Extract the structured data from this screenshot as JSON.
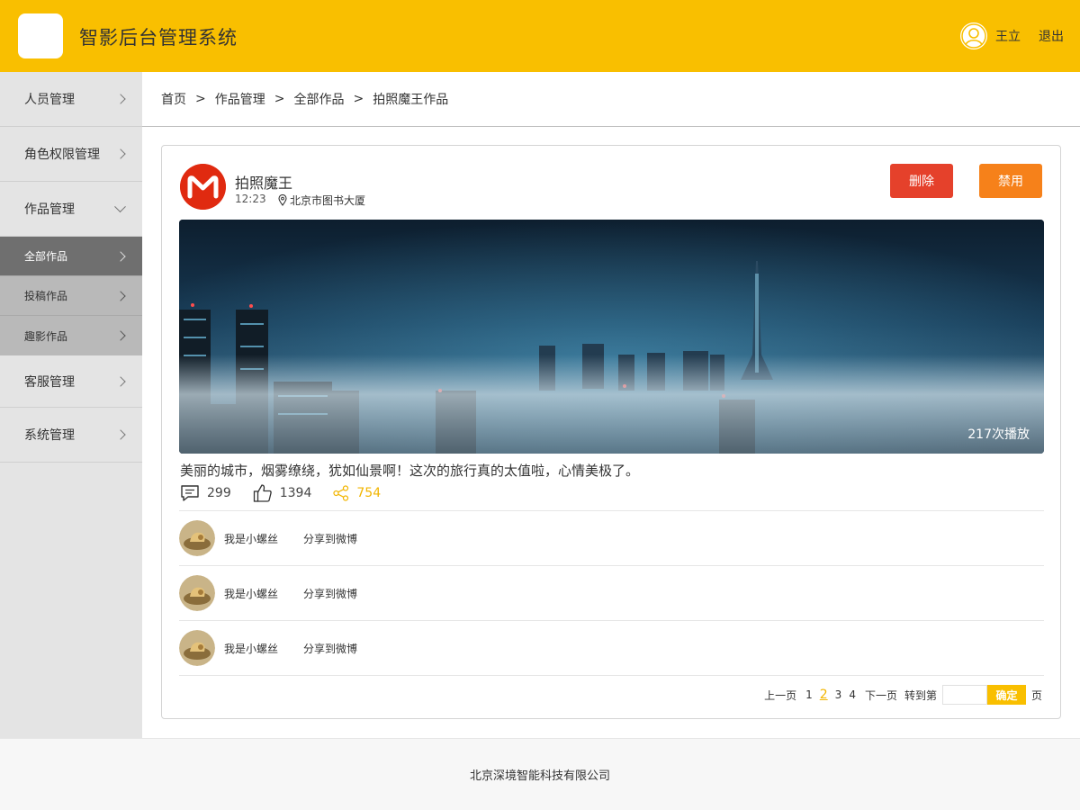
{
  "header": {
    "app_title": "智影后台管理系统",
    "user_name": "王立",
    "logout_label": "退出",
    "brand_color": "#f9bf00"
  },
  "sidebar": {
    "items": [
      {
        "label": "人员管理"
      },
      {
        "label": "角色权限管理"
      },
      {
        "label": "作品管理",
        "expanded": true
      },
      {
        "label": "全部作品",
        "sub": true,
        "active": true
      },
      {
        "label": "投稿作品",
        "sub": true
      },
      {
        "label": "趣影作品",
        "sub": true
      },
      {
        "label": "客服管理"
      },
      {
        "label": "系统管理"
      }
    ]
  },
  "breadcrumb": {
    "items": [
      "首页",
      "作品管理",
      "全部作品",
      "拍照魔王作品"
    ],
    "separator": ">"
  },
  "post": {
    "author": "拍照魔王",
    "time": "12:23",
    "location": "北京市图书大厦",
    "delete_label": "删除",
    "ban_label": "禁用",
    "play_count": "217次播放",
    "caption": "美丽的城市，烟雾缭绕，犹如仙景啊！这次的旅行真的太值啦，心情美极了。",
    "comments": "299",
    "likes": "1394",
    "shares": "754",
    "delete_color": "#e5412b",
    "ban_color": "#f6811a",
    "share_color": "#f2b500"
  },
  "share_list": [
    {
      "name": "我是小螺丝",
      "action": "分享到微博"
    },
    {
      "name": "我是小螺丝",
      "action": "分享到微博"
    },
    {
      "name": "我是小螺丝",
      "action": "分享到微博"
    }
  ],
  "pagination": {
    "prev_label": "上一页",
    "pages": [
      "1",
      "2",
      "3",
      "4"
    ],
    "current": "2",
    "next_label": "下一页",
    "goto_label": "转到第",
    "confirm_label": "确定",
    "page_unit": "页"
  },
  "footer": {
    "company": "北京深境智能科技有限公司"
  }
}
